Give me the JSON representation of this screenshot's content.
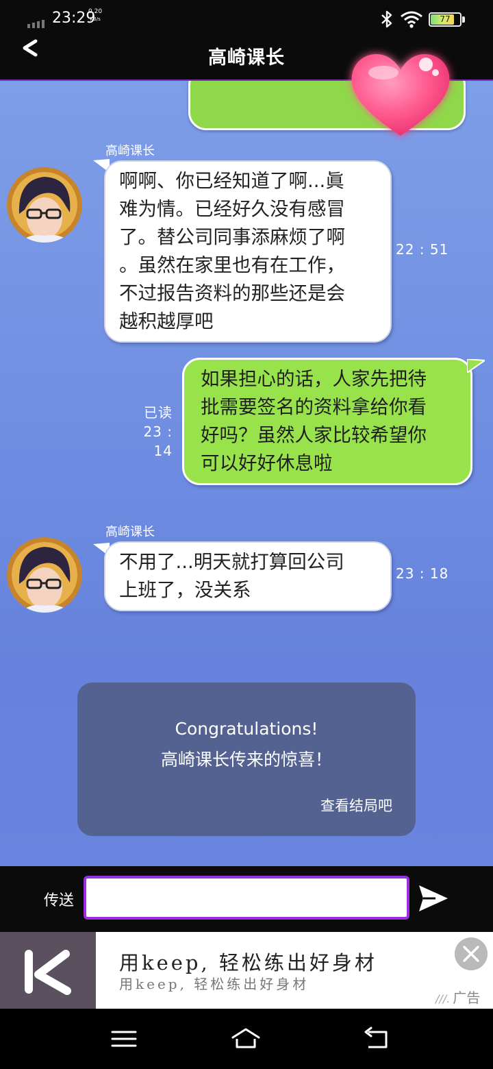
{
  "status_bar": {
    "time": "23:29",
    "speed_value": "0.20",
    "speed_unit": "KB/s",
    "battery": "77",
    "battery_level": 0.77,
    "icons": [
      "signal-icon",
      "bluetooth-icon",
      "wifi-icon",
      "battery-icon"
    ]
  },
  "header": {
    "title": "高崎课长",
    "back_icon": "chevron-left-icon"
  },
  "messages": [
    {
      "direction": "incoming",
      "sender": "高崎课长",
      "lines": [
        "啊啊、你已经知道了啊...眞",
        "难为情。已经好久没有感冒",
        "了。替公司同事添麻烦了啊",
        "。虽然在家里也有在工作，",
        "不过报告资料的那些还是会",
        "越积越厚吧"
      ],
      "time": "22 : 51"
    },
    {
      "direction": "outgoing",
      "status": "已读",
      "time": "23 : 14",
      "lines": [
        "如果担心的话，人家先把待",
        "批需要签名的资料拿给你看",
        "好吗？虽然人家比较希望你",
        "可以好好休息啦"
      ]
    },
    {
      "direction": "incoming",
      "sender": "高崎课长",
      "lines": [
        "不用了...明天就打算回公司",
        "上班了，没关系"
      ],
      "time": "23 : 18"
    }
  ],
  "congrats": {
    "title": "Congratulations!",
    "subtitle": "高崎课长传来的惊喜！",
    "link": "查看结局吧"
  },
  "input_bar": {
    "label": "传送",
    "value": "",
    "send_icon": "send-icon"
  },
  "ad": {
    "title": "用keep,  轻松练出好身材",
    "subtitle": "用keep,  轻松练出好身材",
    "label": "广告",
    "logo_letter": "K"
  },
  "nav_bar": {
    "icons": [
      "menu-icon",
      "home-icon",
      "back-icon"
    ]
  },
  "colors": {
    "accent_purple": "#9b2ee0",
    "outgoing_bubble": "#98e34b",
    "incoming_bubble": "#ffffff",
    "chat_background": "#7190e2"
  }
}
